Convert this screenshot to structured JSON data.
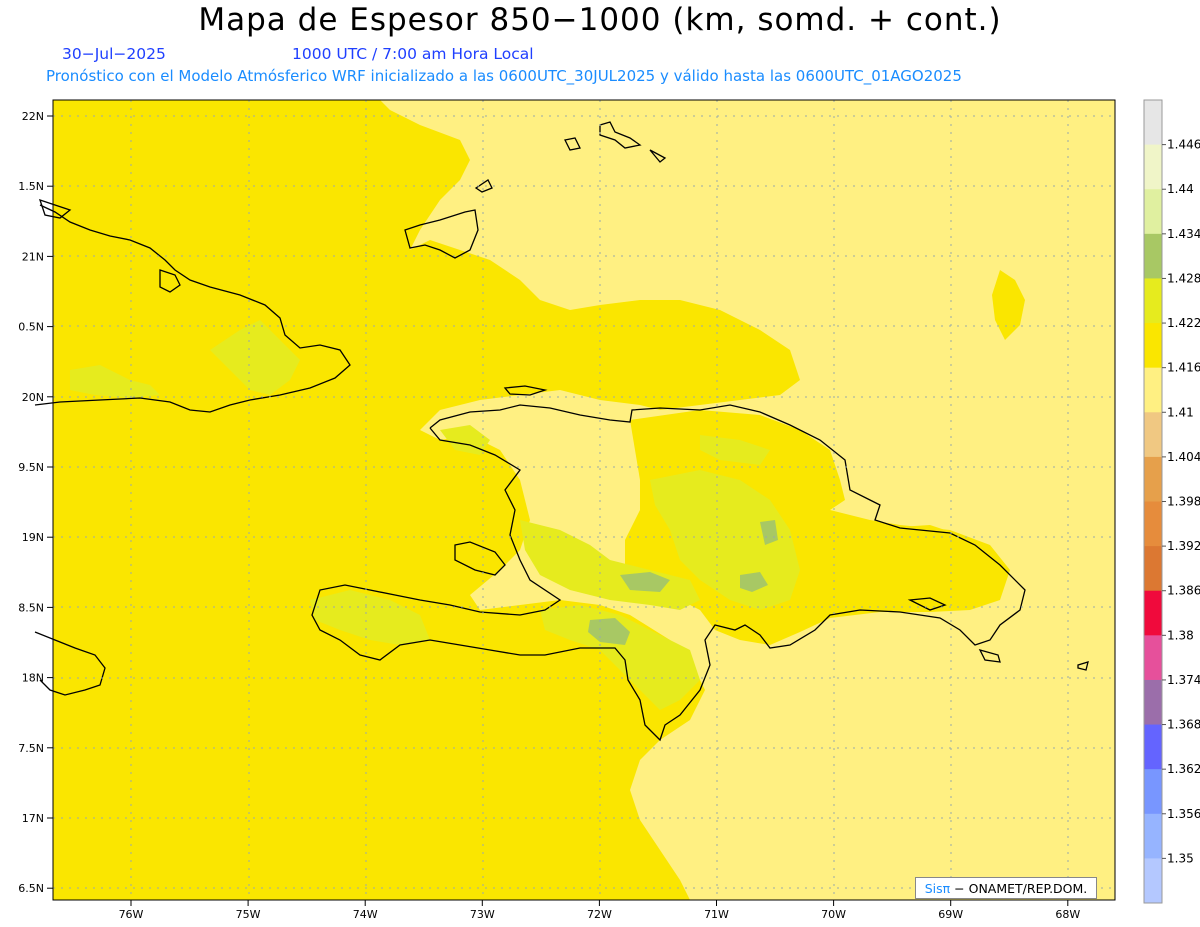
{
  "title": "Mapa de Espesor 850−1000 (km, somd. + cont.)",
  "date": "30−Jul−2025",
  "time": "1000 UTC / 7:00 am Hora Local",
  "forecast": "Pronóstico con el Modelo Atmósferico WRF inicializado a las 0600UTC_30JUL2025 y válido hasta las  0600UTC_01AGO2025",
  "credit": {
    "logo": "Sis",
    "pi": "π",
    "text": "− ONAMET/REP.DOM."
  },
  "lat_labels": [
    "22N",
    "1.5N",
    "21N",
    "0.5N",
    "20N",
    "9.5N",
    "19N",
    "8.5N",
    "18N",
    "7.5N",
    "17N",
    "6.5N"
  ],
  "lon_labels": [
    "76W",
    "75W",
    "74W",
    "73W",
    "72W",
    "71W",
    "70W",
    "69W",
    "68W"
  ],
  "colorbar": {
    "labels": [
      "1.446",
      "1.44",
      "1.434",
      "1.428",
      "1.422",
      "1.416",
      "1.41",
      "1.404",
      "1.398",
      "1.392",
      "1.386",
      "1.38",
      "1.374",
      "1.368",
      "1.362",
      "1.356",
      "1.35"
    ],
    "colors": [
      "#e6e6e6",
      "#f0f5c8",
      "#e0f0a0",
      "#a8c864",
      "#e6eb1e",
      "#fae600",
      "#fff082",
      "#f0c882",
      "#e6a04b",
      "#e68c3c",
      "#dc7832",
      "#f00a3c",
      "#e6509b",
      "#9b6eaa",
      "#6464ff",
      "#7896ff",
      "#96b4ff",
      "#b4c8ff"
    ]
  },
  "colors": {
    "yellow": "#fae600",
    "light_yellow": "#fff082",
    "green_yellow": "#e6eb1e",
    "olive": "#a8c864"
  }
}
